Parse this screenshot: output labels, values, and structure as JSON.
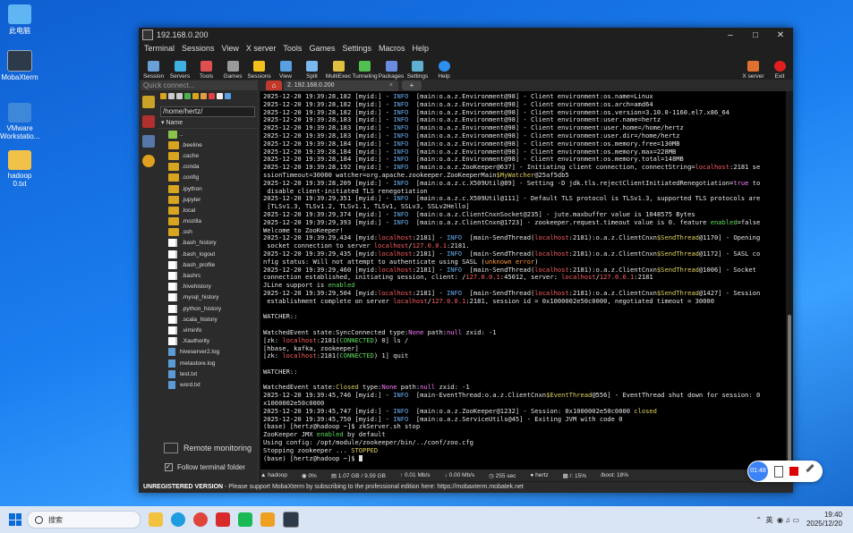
{
  "desktop": {
    "icons": [
      {
        "label": "此电脑"
      },
      {
        "label": "MobaXterm"
      },
      {
        "label": "VMware Workstatio..."
      },
      {
        "label": "hadoop 0.txt"
      }
    ]
  },
  "window": {
    "title": "192.168.0.200",
    "menu": [
      "Terminal",
      "Sessions",
      "View",
      "X server",
      "Tools",
      "Games",
      "Settings",
      "Macros",
      "Help"
    ],
    "toolbar": [
      "Session",
      "Servers",
      "Tools",
      "Games",
      "Sessions",
      "View",
      "Split",
      "MultiExec",
      "Tunneling",
      "Packages",
      "Settings",
      "Help"
    ],
    "toolbar_right": [
      "X server",
      "Exit"
    ],
    "quick_connect": "Quick connect...",
    "tab_label": "2. 192.168.0.200",
    "unregistered": {
      "bold": "UNREGISTERED VERSION",
      "text": "  -  Please support MobaXterm by subscribing to the professional edition here:  https://mobaxterm.mobatek.net"
    }
  },
  "sidebar": {
    "path": "/home/hertz/",
    "name_header": "Name",
    "files": [
      {
        "name": "..",
        "type": "updir"
      },
      {
        "name": ".beeline",
        "type": "folder"
      },
      {
        "name": ".cache",
        "type": "folder"
      },
      {
        "name": ".conda",
        "type": "folder"
      },
      {
        "name": ".config",
        "type": "folder"
      },
      {
        "name": ".ipython",
        "type": "folder"
      },
      {
        "name": ".jupyter",
        "type": "folder"
      },
      {
        "name": ".local",
        "type": "folder"
      },
      {
        "name": ".mozilla",
        "type": "folder"
      },
      {
        "name": ".ssh",
        "type": "folder"
      },
      {
        "name": ".bash_history",
        "type": "file"
      },
      {
        "name": ".bash_logout",
        "type": "file"
      },
      {
        "name": ".bash_profile",
        "type": "file"
      },
      {
        "name": ".bashrc",
        "type": "file"
      },
      {
        "name": ".hivehistory",
        "type": "file"
      },
      {
        "name": ".mysql_history",
        "type": "file"
      },
      {
        "name": ".python_history",
        "type": "file"
      },
      {
        "name": ".scala_history",
        "type": "file"
      },
      {
        "name": ".viminfo",
        "type": "file"
      },
      {
        "name": ".Xauthority",
        "type": "file"
      },
      {
        "name": "hiveserver2.log",
        "type": "log"
      },
      {
        "name": "metastore.log",
        "type": "log"
      },
      {
        "name": "test.txt",
        "type": "log"
      },
      {
        "name": "word.txt",
        "type": "log"
      }
    ],
    "remote_monitoring": "Remote monitoring",
    "follow_terminal": "Follow terminal folder"
  },
  "terminal": {
    "lines": [
      [
        [
          "2025-12-20 19:39:28,182 [myid:] - ",
          ""
        ],
        [
          "INFO ",
          "c-blue"
        ],
        [
          " [main:o.a.z.Environment@98] - Client environment:os.name=Linux",
          ""
        ]
      ],
      [
        [
          "2025-12-20 19:39:28,182 [myid:] - ",
          ""
        ],
        [
          "INFO ",
          "c-blue"
        ],
        [
          " [main:o.a.z.Environment@98] - Client environment:os.arch=amd64",
          ""
        ]
      ],
      [
        [
          "2025-12-20 19:39:28,182 [myid:] - ",
          ""
        ],
        [
          "INFO ",
          "c-blue"
        ],
        [
          " [main:o.a.z.Environment@98] - Client environment:os.version=3.10.0-1160.el7.x86_64",
          ""
        ]
      ],
      [
        [
          "2025-12-20 19:39:28,183 [myid:] - ",
          ""
        ],
        [
          "INFO ",
          "c-blue"
        ],
        [
          " [main:o.a.z.Environment@98] - Client environment:user.name=hertz",
          ""
        ]
      ],
      [
        [
          "2025-12-20 19:39:28,183 [myid:] - ",
          ""
        ],
        [
          "INFO ",
          "c-blue"
        ],
        [
          " [main:o.a.z.Environment@98] - Client environment:user.home=/home/hertz",
          ""
        ]
      ],
      [
        [
          "2025-12-20 19:39:28,183 [myid:] - ",
          ""
        ],
        [
          "INFO ",
          "c-blue"
        ],
        [
          " [main:o.a.z.Environment@98] - Client environment:user.dir=/home/hertz",
          ""
        ]
      ],
      [
        [
          "2025-12-20 19:39:28,184 [myid:] - ",
          ""
        ],
        [
          "INFO ",
          "c-blue"
        ],
        [
          " [main:o.a.z.Environment@98] - Client environment:os.memory.free=130MB",
          ""
        ]
      ],
      [
        [
          "2025-12-20 19:39:28,184 [myid:] - ",
          ""
        ],
        [
          "INFO ",
          "c-blue"
        ],
        [
          " [main:o.a.z.Environment@98] - Client environment:os.memory.max=228MB",
          ""
        ]
      ],
      [
        [
          "2025-12-20 19:39:28,184 [myid:] - ",
          ""
        ],
        [
          "INFO ",
          "c-blue"
        ],
        [
          " [main:o.a.z.Environment@98] - Client environment:os.memory.total=148MB",
          ""
        ]
      ],
      [
        [
          "2025-12-20 19:39:28,192 [myid:] - ",
          ""
        ],
        [
          "INFO ",
          "c-blue"
        ],
        [
          " [main:o.a.z.ZooKeeper@637] - Initiating client connection, connectString=",
          ""
        ],
        [
          "localhost",
          "c-red"
        ],
        [
          ":2181 se",
          ""
        ]
      ],
      [
        [
          "ssionTimeout=30000 watcher=org.apache.zookeeper.ZooKeeperMain",
          ""
        ],
        [
          "$MyWatcher",
          "c-yel"
        ],
        [
          "@25af5db5",
          ""
        ]
      ],
      [
        [
          "2025-12-20 19:39:28,209 [myid:] - ",
          ""
        ],
        [
          "INFO ",
          "c-blue"
        ],
        [
          " [main:o.a.z.c.X509Util@89] - Setting -D jdk.tls.rejectClientInitiatedRenegotiation=",
          ""
        ],
        [
          "true",
          "c-mag"
        ],
        [
          " to",
          ""
        ]
      ],
      [
        [
          " disable client-initiated TLS renegotiation",
          ""
        ]
      ],
      [
        [
          "2025-12-20 19:39:29,351 [myid:] - ",
          ""
        ],
        [
          "INFO ",
          "c-blue"
        ],
        [
          " [main:o.a.z.c.X509Util@111] - Default TLS protocol is TLSv1.3, supported TLS protocols are",
          ""
        ]
      ],
      [
        [
          " [TLSv1.3, TLSv1.2, TLSv1.1, TLSv1, SSLv3, SSLv2Hello]",
          ""
        ]
      ],
      [
        [
          "2025-12-20 19:39:29,374 [myid:] - ",
          ""
        ],
        [
          "INFO ",
          "c-blue"
        ],
        [
          " [main:o.a.z.ClientCnxnSocket@235] - jute.maxbuffer value is 1048575 Bytes",
          ""
        ]
      ],
      [
        [
          "2025-12-20 19:39:29,393 [myid:] - ",
          ""
        ],
        [
          "INFO ",
          "c-blue"
        ],
        [
          " [main:o.a.z.ClientCnxn@1723] - zookeeper.request.timeout value is 0. feature ",
          ""
        ],
        [
          "enabled",
          "c-grn"
        ],
        [
          "=false",
          ""
        ]
      ],
      [
        [
          "Welcome to ZooKeeper!",
          ""
        ]
      ],
      [
        [
          "2025-12-20 19:39:29,434 [myid:",
          ""
        ],
        [
          "localhost",
          "c-red"
        ],
        [
          ":2181] - ",
          ""
        ],
        [
          "INFO ",
          "c-blue"
        ],
        [
          " [main-SendThread(",
          ""
        ],
        [
          "localhost",
          "c-red"
        ],
        [
          ":2181):o.a.z.ClientCnxn",
          ""
        ],
        [
          "$SendThread",
          "c-yel"
        ],
        [
          "@1170] - Opening",
          ""
        ]
      ],
      [
        [
          " socket connection to server ",
          ""
        ],
        [
          "localhost",
          "c-red"
        ],
        [
          "/",
          ""
        ],
        [
          "127.0.0.1",
          "c-red"
        ],
        [
          ":2181.",
          ""
        ]
      ],
      [
        [
          "2025-12-20 19:39:29,435 [myid:",
          ""
        ],
        [
          "localhost",
          "c-red"
        ],
        [
          ":2181] - ",
          ""
        ],
        [
          "INFO ",
          "c-blue"
        ],
        [
          " [main-SendThread(",
          ""
        ],
        [
          "localhost",
          "c-red"
        ],
        [
          ":2181):o.a.z.ClientCnxn",
          ""
        ],
        [
          "$SendThread",
          "c-yel"
        ],
        [
          "@1172] - SASL co",
          ""
        ]
      ],
      [
        [
          "nfig status: Will not attempt to authenticate using SASL (",
          ""
        ],
        [
          "unknown error",
          "c-org"
        ],
        [
          ")",
          ""
        ]
      ],
      [
        [
          "2025-12-20 19:39:29,460 [myid:",
          ""
        ],
        [
          "localhost",
          "c-red"
        ],
        [
          ":2181] - ",
          ""
        ],
        [
          "INFO ",
          "c-blue"
        ],
        [
          " [main-SendThread(",
          ""
        ],
        [
          "localhost",
          "c-red"
        ],
        [
          ":2181):o.a.z.ClientCnxn",
          ""
        ],
        [
          "$SendThread",
          "c-yel"
        ],
        [
          "@1006] - Socket",
          ""
        ]
      ],
      [
        [
          "connection established, initiating session, client: /",
          ""
        ],
        [
          "127.0.0.1",
          "c-red"
        ],
        [
          ":45012, server: ",
          ""
        ],
        [
          "localhost",
          "c-red"
        ],
        [
          "/",
          ""
        ],
        [
          "127.0.0.1",
          "c-red"
        ],
        [
          ":2181",
          ""
        ]
      ],
      [
        [
          "JLine support is ",
          ""
        ],
        [
          "enabled",
          "c-grn"
        ]
      ],
      [
        [
          "2025-12-20 19:39:29,504 [myid:",
          ""
        ],
        [
          "localhost",
          "c-red"
        ],
        [
          ":2181] - ",
          ""
        ],
        [
          "INFO ",
          "c-blue"
        ],
        [
          " [main-SendThread(",
          ""
        ],
        [
          "localhost",
          "c-red"
        ],
        [
          ":2181):o.a.z.ClientCnxn",
          ""
        ],
        [
          "$SendThread",
          "c-yel"
        ],
        [
          "@1427] - Session",
          ""
        ]
      ],
      [
        [
          " establishment complete on server ",
          ""
        ],
        [
          "localhost",
          "c-red"
        ],
        [
          "/",
          ""
        ],
        [
          "127.0.0.1",
          "c-red"
        ],
        [
          ":2181, session id = 0x1000002e50c0000, negotiated timeout = 30000",
          ""
        ]
      ],
      [
        [
          "",
          ""
        ]
      ],
      [
        [
          "WATCHER::",
          ""
        ]
      ],
      [
        [
          "",
          ""
        ]
      ],
      [
        [
          "WatchedEvent state:SyncConnected type:",
          ""
        ],
        [
          "None",
          "c-mag"
        ],
        [
          " path:",
          ""
        ],
        [
          "null",
          "c-mag"
        ],
        [
          " zxid: -1",
          ""
        ]
      ],
      [
        [
          "[zk: ",
          ""
        ],
        [
          "localhost",
          "c-red"
        ],
        [
          ":2181(",
          ""
        ],
        [
          "CONNECTED",
          "c-grn"
        ],
        [
          ") 0] ls /",
          ""
        ]
      ],
      [
        [
          "[hbase, kafka, zookeeper]",
          ""
        ]
      ],
      [
        [
          "[zk: ",
          ""
        ],
        [
          "localhost",
          "c-red"
        ],
        [
          ":2181(",
          ""
        ],
        [
          "CONNECTED",
          "c-grn"
        ],
        [
          ") 1] quit",
          ""
        ]
      ],
      [
        [
          "",
          ""
        ]
      ],
      [
        [
          "WATCHER::",
          ""
        ]
      ],
      [
        [
          "",
          ""
        ]
      ],
      [
        [
          "WatchedEvent state:",
          ""
        ],
        [
          "Closed",
          "c-yel"
        ],
        [
          " type:",
          ""
        ],
        [
          "None",
          "c-mag"
        ],
        [
          " path:",
          ""
        ],
        [
          "null",
          "c-mag"
        ],
        [
          " zxid: -1",
          ""
        ]
      ],
      [
        [
          "2025-12-20 19:39:45,746 [myid:] - ",
          ""
        ],
        [
          "INFO ",
          "c-blue"
        ],
        [
          " [main-EventThread:o.a.z.ClientCnxn",
          ""
        ],
        [
          "$EventThread",
          "c-yel"
        ],
        [
          "@556] - EventThread shut down for session: 0",
          ""
        ]
      ],
      [
        [
          "x1000002e50c0000",
          ""
        ]
      ],
      [
        [
          "2025-12-20 19:39:45,747 [myid:] - ",
          ""
        ],
        [
          "INFO ",
          "c-blue"
        ],
        [
          " [main:o.a.z.ZooKeeper@1232] - Session: 0x1000002e50c0000 ",
          ""
        ],
        [
          "closed",
          "c-yel"
        ]
      ],
      [
        [
          "2025-12-20 19:39:45,750 [myid:] - ",
          ""
        ],
        [
          "INFO ",
          "c-blue"
        ],
        [
          " [main:o.a.z.ServiceUtils@45] - Exiting JVM with code 0",
          ""
        ]
      ],
      [
        [
          "(base) [hertz@hadoop ~]$ zkServer.sh stop",
          ""
        ]
      ],
      [
        [
          "ZooKeeper JMX ",
          ""
        ],
        [
          "enabled",
          "c-grn"
        ],
        [
          " by default",
          ""
        ]
      ],
      [
        [
          "Using config: /opt/module/zookeeper/bin/../conf/zoo.cfg",
          ""
        ]
      ],
      [
        [
          "Stopping zookeeper ... ",
          ""
        ],
        [
          "STOPPED",
          "c-yel"
        ]
      ],
      [
        [
          "(base) [hertz@hadoop ~]$ ",
          ""
        ]
      ]
    ]
  },
  "statusbar": [
    "hadoop",
    "0%",
    "1.07 GB / 9.59 GB",
    "0.01 Mb/s",
    "0.00 Mb/s",
    "255 sec",
    "hertz",
    "/: 15%",
    "/boot: 18%"
  ],
  "float_widget": {
    "timer": "01:48"
  },
  "taskbar": {
    "search_placeholder": "搜索",
    "lang": "英",
    "time": "19:40",
    "date": "2025/12/20"
  },
  "colors": {
    "accent": "#0a6cd6",
    "terminal_bg": "#000000",
    "info": "#6ab0f3",
    "host": "#ff5f5f"
  }
}
